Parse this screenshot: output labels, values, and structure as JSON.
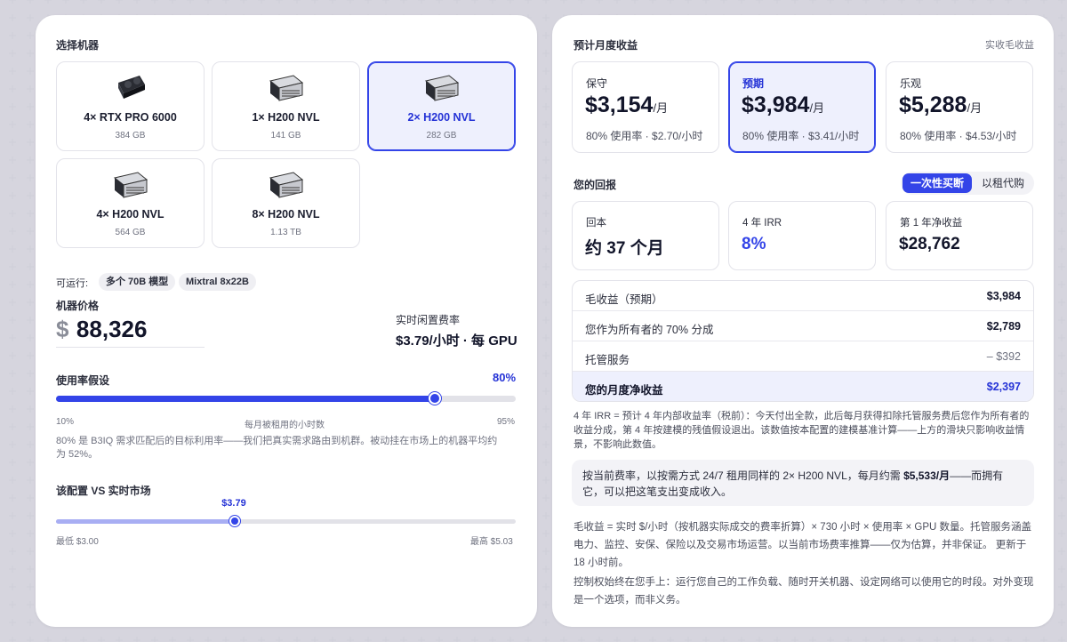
{
  "left": {
    "select_machine_label": "选择机器",
    "machines": [
      {
        "name": "4× RTX PRO 6000",
        "memory": "384 GB",
        "icon": "gpu-card-icon",
        "selected": false
      },
      {
        "name": "1× H200 NVL",
        "memory": "141 GB",
        "icon": "server-icon",
        "selected": false
      },
      {
        "name": "2× H200 NVL",
        "memory": "282 GB",
        "icon": "server-icon",
        "selected": true
      },
      {
        "name": "4× H200 NVL",
        "memory": "564 GB",
        "icon": "server-icon",
        "selected": false
      },
      {
        "name": "8× H200 NVL",
        "memory": "1.13 TB",
        "icon": "server-icon",
        "selected": false
      }
    ],
    "runnable_label": "可运行:",
    "runnable_chips": [
      "多个 70B 模型",
      "Mixtral 8x22B"
    ],
    "price_label": "机器价格",
    "price_currency": "$",
    "price_value": "88,326",
    "realtime_rate_label": "实时闲置费率",
    "realtime_rate_value": "$3.79/小时 · 每 GPU",
    "utilization_label": "使用率假设",
    "utilization_value_text": "80%",
    "utilization_value": 0.8,
    "utilization_min": "10%",
    "utilization_mid": "每月被租用的小时数",
    "utilization_max": "95%",
    "utilization_note": "80% 是 B3IQ 需求匹配后的目标利用率——我们把真实需求路由到机群。被动挂在市场上的机器平均约为 52%。",
    "market_label": "该配置 VS 实时市场",
    "market_value_text": "$3.79",
    "market_value": 3.79,
    "market_min": 3.0,
    "market_max": 5.03,
    "market_min_text": "最低 $3.00",
    "market_max_text": "最高 $5.03"
  },
  "right": {
    "monthly_label": "预计月度收益",
    "gross_link": "实收毛收益",
    "scenarios": [
      {
        "label": "保守",
        "amount": "$3,154",
        "per": "/月",
        "detail": "80% 使用率 · $2.70/小时",
        "selected": false
      },
      {
        "label": "预期",
        "amount": "$3,984",
        "per": "/月",
        "detail": "80% 使用率 · $3.41/小时",
        "selected": true
      },
      {
        "label": "乐观",
        "amount": "$5,288",
        "per": "/月",
        "detail": "80% 使用率 · $4.53/小时",
        "selected": false
      }
    ],
    "returns_label": "您的回报",
    "toggle_on": "一次性买断",
    "toggle_off": "以租代购",
    "returns": [
      {
        "label": "回本",
        "value": "约 37 个月"
      },
      {
        "label": "4 年 IRR",
        "value": "8%"
      },
      {
        "label": "第 1 年净收益",
        "value": "$28,762"
      }
    ],
    "table": [
      {
        "k": "毛收益（预期）",
        "v": "$3,984"
      },
      {
        "k": "您作为所有者的 70% 分成",
        "v": "$2,789"
      },
      {
        "k": "托管服务",
        "v": "– $392"
      },
      {
        "k": "您的月度净收益",
        "v": "$2,397"
      }
    ],
    "irr_note": "4 年 IRR = 预计 4 年内部收益率（税前）：今天付出全款，此后每月获得扣除托管服务费后您作为所有者的收益分成，第 4 年按建模的残值假设退出。该数值按本配置的建模基准计算——上方的滑块只影响收益情景，不影响此数值。",
    "callout_pre": "按当前费率，以按需方式 24/7 租用同样的 2× H200 NVL，每月约需 ",
    "callout_bold": "$5,533/月",
    "callout_post": "——而拥有它，可以把这笔支出变成收入。",
    "gross_note": "毛收益 = 实时 $/小时（按机器实际成交的费率折算）× 730 小时 × 使用率 × GPU 数量。托管服务涵盖电力、监控、安保、保险以及交易市场运营。以当前市场费率推算——仅为估算，并非保证。 更新于 18 小时前。",
    "control_note": "控制权始终在您手上：运行您自己的工作负载、随时开关机器、设定网络可以使用它的时段。对外变现是一个选项，而非义务。"
  }
}
